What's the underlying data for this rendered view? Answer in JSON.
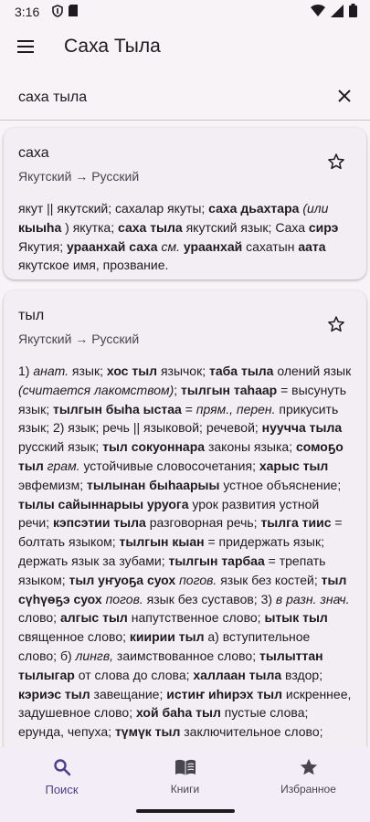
{
  "status_bar": {
    "time": "3:16",
    "icons": [
      "shield-icon",
      "sim-card-icon",
      "wifi-icon",
      "signal-icon",
      "battery-icon"
    ]
  },
  "app_bar": {
    "title": "Саха Тыла",
    "menu_icon": "menu-icon"
  },
  "search": {
    "value": "саха тыла",
    "clear_icon": "close-icon"
  },
  "results": [
    {
      "word": "саха",
      "direction": "Якутский → Русский",
      "starred": false,
      "body_html": "якут || якутский; сахалар якуты; <b>саха дьахтара</b> <i>(или</i> <b>кыыһа</b> ) якутка; <b>саха тыла</b> якутский язык; Саха <b>сирэ</b> Якутия; <b>ураанхай саха</b> <i>см.</i> <b>ураанхай</b> сахатын <b>аата</b> якутское имя, прозвание."
    },
    {
      "word": "тыл",
      "direction": "Якутский → Русский",
      "starred": false,
      "body_html": "1) <i>анат.</i> язык; <b>хос тыл</b> язычок; <b>таба тыла</b> олений язык <i>(считается лакомством)</i>; <b>тылгын таһаар</b> = высунуть язык; <b>тылгын быһа ыстаа</b> = <i>прям., перен.</i> прикусить язык; 2) язык; речь || языковой; речевой; <b>нуучча тыла</b> русский язык; <b>тыл сокуоннара</b> законы языка; <b>сомоҕо тыл</b> <i>грам.</i> устойчивые словосочетания; <b>харыс тыл</b> эвфемизм; <b>тылынан быһаарыы</b> устное объяснение; <b>тылы сайыннарыы уруога</b> урок развития устной речи; <b>кэпсэтии тыла</b> разговорная речь; <b>тылга тиис</b> = болтать языком; <b>тылгын кыан</b> = придержать язык; держать язык за зубами; <b>тылгын тарбаа</b> = трепать языком; <b>тыл уҥуоҕа суох</b> <i>погов.</i> язык без костей; <b>тыл сүһүөҕэ суох</b> <i>погов.</i> язык без суставов; 3) <i>в разн. знач.</i> слово; <b>алгыс тыл</b> напутственное слово; <b>ытык тыл</b> священное слово; <b>киирии тыл</b> а) вступительное слово; б) <i>лингв,</i> заимствованное слово; <b>тылыттан тылыгар</b> от слова до слова; <b>халлаан тыла</b> вздор; <b>кэриэс тыл</b> завещание; <b>истиҥ иһирэх тыл</b> искреннее, задушевное слово; <b>хой баһа тыл</b> пустые слова; ерунда, чепуха; <b>түмүк тыл</b> заключительное слово; <b>тыл суолтата</b> значение слова; <b>дьон тыла</b> людская молва; <b>аҕа тыла</b> отцовский наказ; <b>тылын ыл</b> = послушаться"
    }
  ],
  "bottom_nav": {
    "items": [
      {
        "label": "Поиск",
        "icon": "search-icon",
        "active": true
      },
      {
        "label": "Книги",
        "icon": "book-icon",
        "active": false
      },
      {
        "label": "Избранное",
        "icon": "star-icon",
        "active": false
      }
    ]
  },
  "colors": {
    "background": "#f7f3f6",
    "card": "#f3eef3",
    "nav_background": "#f3edf7",
    "accent": "#4a3f8a",
    "text_primary": "#1d1b20",
    "text_secondary": "#49454f"
  }
}
